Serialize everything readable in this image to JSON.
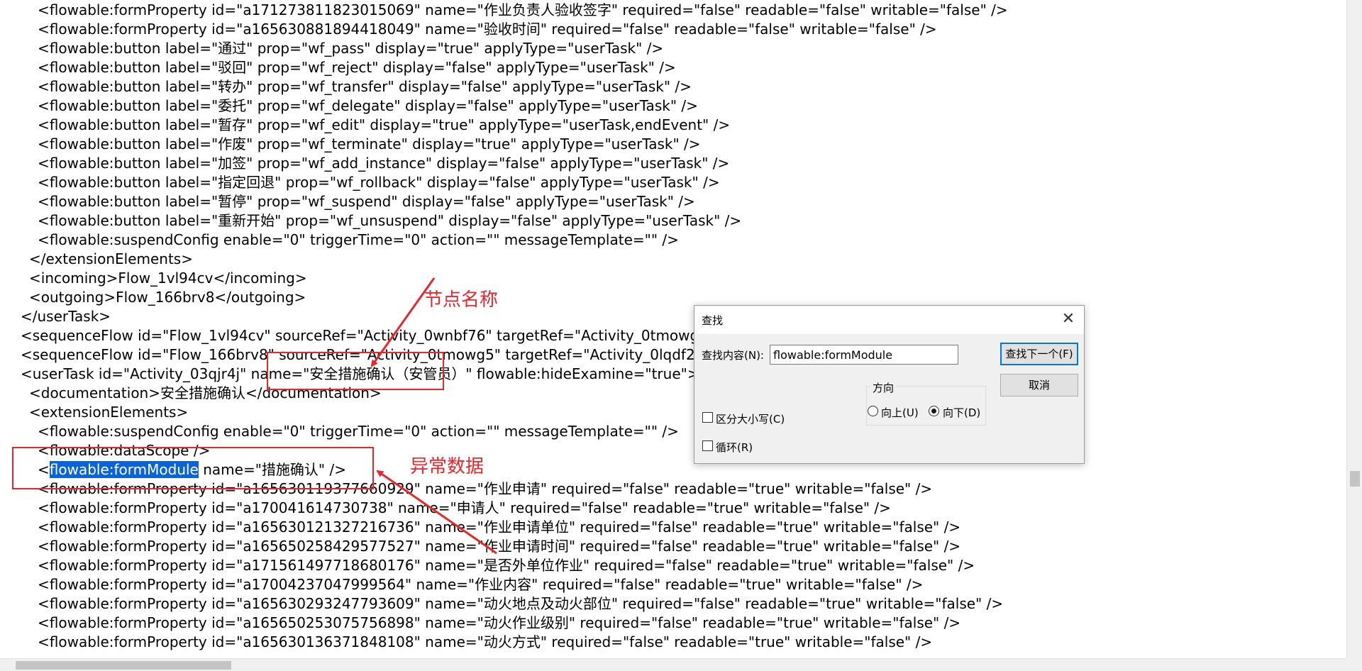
{
  "editor": {
    "lines": [
      {
        "indent": 3,
        "text": "<flowable:formProperty id=\"a171273811823015069\" name=\"作业负责人验收签字\" required=\"false\" readable=\"false\" writable=\"false\" />"
      },
      {
        "indent": 3,
        "text": "<flowable:formProperty id=\"a165630881894418049\" name=\"验收时间\" required=\"false\" readable=\"false\" writable=\"false\" />"
      },
      {
        "indent": 3,
        "text": "<flowable:button label=\"通过\" prop=\"wf_pass\" display=\"true\" applyType=\"userTask\" />"
      },
      {
        "indent": 3,
        "text": "<flowable:button label=\"驳回\" prop=\"wf_reject\" display=\"false\" applyType=\"userTask\" />"
      },
      {
        "indent": 3,
        "text": "<flowable:button label=\"转办\" prop=\"wf_transfer\" display=\"false\" applyType=\"userTask\" />"
      },
      {
        "indent": 3,
        "text": "<flowable:button label=\"委托\" prop=\"wf_delegate\" display=\"false\" applyType=\"userTask\" />"
      },
      {
        "indent": 3,
        "text": "<flowable:button label=\"暂存\" prop=\"wf_edit\" display=\"true\" applyType=\"userTask,endEvent\" />"
      },
      {
        "indent": 3,
        "text": "<flowable:button label=\"作废\" prop=\"wf_terminate\" display=\"true\" applyType=\"userTask\" />"
      },
      {
        "indent": 3,
        "text": "<flowable:button label=\"加签\" prop=\"wf_add_instance\" display=\"false\" applyType=\"userTask\" />"
      },
      {
        "indent": 3,
        "text": "<flowable:button label=\"指定回退\" prop=\"wf_rollback\" display=\"false\" applyType=\"userTask\" />"
      },
      {
        "indent": 3,
        "text": "<flowable:button label=\"暂停\" prop=\"wf_suspend\" display=\"false\" applyType=\"userTask\" />"
      },
      {
        "indent": 3,
        "text": "<flowable:button label=\"重新开始\" prop=\"wf_unsuspend\" display=\"false\" applyType=\"userTask\" />"
      },
      {
        "indent": 3,
        "text": "<flowable:suspendConfig enable=\"0\" triggerTime=\"0\" action=\"\" messageTemplate=\"\" />"
      },
      {
        "indent": 2,
        "text": "</extensionElements>"
      },
      {
        "indent": 2,
        "text": "<incoming>Flow_1vl94cv</incoming>"
      },
      {
        "indent": 2,
        "text": "<outgoing>Flow_166brv8</outgoing>"
      },
      {
        "indent": 1,
        "text": "</userTask>"
      },
      {
        "indent": 1,
        "text": "<sequenceFlow id=\"Flow_1vl94cv\" sourceRef=\"Activity_0wnbf76\" targetRef=\"Activity_0tmowg5\" />"
      },
      {
        "indent": 1,
        "text": "<sequenceFlow id=\"Flow_166brv8\" sourceRef=\"Activity_0tmowg5\" targetRef=\"Activity_0lqdf2a\" />"
      },
      {
        "indent": 1,
        "text": "<userTask id=\"Activity_03qjr4j\" name=\"安全措施确认（安管员）\" flowable:hideExamine=\"true\">"
      },
      {
        "indent": 2,
        "text": "<documentation>安全措施确认</documentation>"
      },
      {
        "indent": 2,
        "text": "<extensionElements>"
      },
      {
        "indent": 3,
        "text": "<flowable:suspendConfig enable=\"0\" triggerTime=\"0\" action=\"\" messageTemplate=\"\" />"
      },
      {
        "indent": 3,
        "text": "<flowable:dataScope />"
      },
      {
        "indent": 3,
        "before": "<",
        "highlight": "flowable:formModule",
        "after": " name=\"措施确认\" />"
      },
      {
        "indent": 3,
        "text": "<flowable:formProperty id=\"a165630119377660929\" name=\"作业申请\" required=\"false\" readable=\"true\" writable=\"false\" />"
      },
      {
        "indent": 3,
        "text": "<flowable:formProperty id=\"a170041614730738\" name=\"申请人\" required=\"false\" readable=\"true\" writable=\"false\" />"
      },
      {
        "indent": 3,
        "text": "<flowable:formProperty id=\"a165630121327216736\" name=\"作业申请单位\" required=\"false\" readable=\"true\" writable=\"false\" />"
      },
      {
        "indent": 3,
        "text": "<flowable:formProperty id=\"a165650258429577527\" name=\"作业申请时间\" required=\"false\" readable=\"true\" writable=\"false\" />"
      },
      {
        "indent": 3,
        "text": "<flowable:formProperty id=\"a171561497718680176\" name=\"是否外单位作业\" required=\"false\" readable=\"true\" writable=\"false\" />"
      },
      {
        "indent": 3,
        "text": "<flowable:formProperty id=\"a17004237047999564\" name=\"作业内容\" required=\"false\" readable=\"true\" writable=\"false\" />"
      },
      {
        "indent": 3,
        "text": "<flowable:formProperty id=\"a165630293247793609\" name=\"动火地点及动火部位\" required=\"false\" readable=\"true\" writable=\"false\" />"
      },
      {
        "indent": 3,
        "text": "<flowable:formProperty id=\"a165650253075756898\" name=\"动火作业级别\" required=\"false\" readable=\"true\" writable=\"false\" />"
      },
      {
        "indent": 3,
        "text": "<flowable:formProperty id=\"a165630136371848108\" name=\"动火方式\" required=\"false\" readable=\"true\" writable=\"false\" />"
      }
    ]
  },
  "annotations": {
    "node_name_label": "节点名称",
    "abnormal_data_label": "异常数据",
    "color": "#e8272d"
  },
  "find_dialog": {
    "title": "查找",
    "find_label": "查找内容(N):",
    "find_value": "flowable:formModule",
    "find_next_button": "查找下一个(F)",
    "cancel_button": "取消",
    "direction_label": "方向",
    "up_label": "向上(U)",
    "down_label": "向下(D)",
    "match_case_label": "区分大小写(C)",
    "wrap_label": "循环(R)",
    "close_glyph": "✕",
    "direction_selected": "down",
    "match_case_checked": false,
    "wrap_checked": false
  }
}
